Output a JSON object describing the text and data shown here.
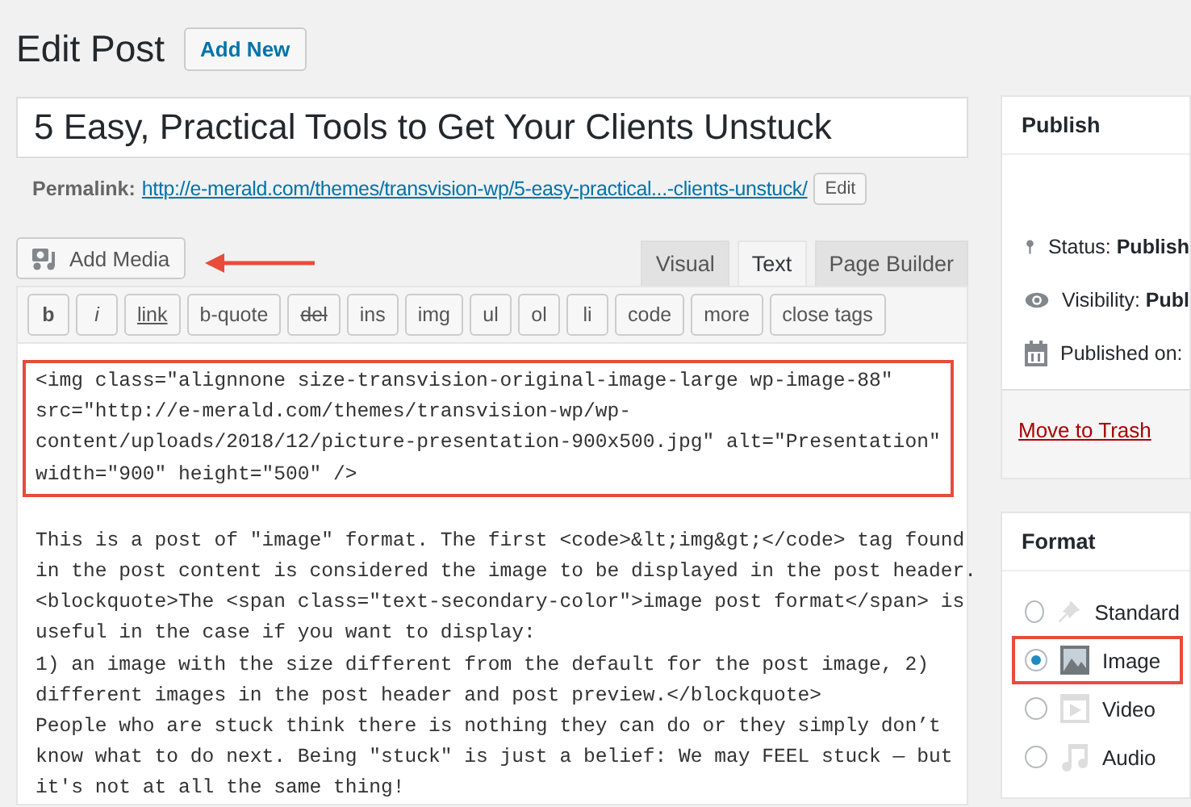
{
  "header": {
    "title": "Edit Post",
    "add_new": "Add New"
  },
  "post_title": {
    "value": "5 Easy, Practical Tools to Get Your Clients Unstuck"
  },
  "permalink": {
    "label": "Permalink:",
    "url": "http://e-merald.com/themes/transvision-wp/5-easy-practical...-clients-unstuck/",
    "edit": "Edit"
  },
  "add_media": {
    "label": "Add Media",
    "annotated": true
  },
  "tabs": [
    {
      "label": "Visual",
      "selected": false
    },
    {
      "label": "Text",
      "selected": true
    },
    {
      "label": "Page Builder",
      "selected": false
    }
  ],
  "toolbar": [
    {
      "label": "b",
      "kind": "bold"
    },
    {
      "label": "i",
      "kind": "italic"
    },
    {
      "label": "link",
      "kind": "underline"
    },
    {
      "label": "b-quote",
      "kind": "plain"
    },
    {
      "label": "del",
      "kind": "strike"
    },
    {
      "label": "ins",
      "kind": "plain"
    },
    {
      "label": "img",
      "kind": "plain"
    },
    {
      "label": "ul",
      "kind": "plain"
    },
    {
      "label": "ol",
      "kind": "plain"
    },
    {
      "label": "li",
      "kind": "plain"
    },
    {
      "label": "code",
      "kind": "plain"
    },
    {
      "label": "more",
      "kind": "plain"
    },
    {
      "label": "close tags",
      "kind": "plain"
    }
  ],
  "editor": {
    "blocks": [
      {
        "text": "<img class=\"alignnone size-transvision-original-image-large wp-image-88\"\nsrc=\"http://e-merald.com/themes/transvision-wp/wp-\ncontent/uploads/2018/12/picture-presentation-900x500.jpg\" alt=\"Presentation\"\nwidth=\"900\" height=\"500\" />",
        "highlighted": true
      },
      {
        "text": "This is a post of \"image\" format. The first <code>&lt;img&gt;</code> tag found\nin the post content is considered the image to be displayed in the post header.\n<blockquote>The <span class=\"text-secondary-color\">image post format</span> is\nuseful in the case if you want to display:\n1) an image with the size different from the default for the post image, 2)\ndifferent images in the post header and post preview.</blockquote>\nPeople who are stuck think there is nothing they can do or they simply don’t\nknow what to do next. Being \"stuck\" is just a belief: We may FEEL stuck — but\nit's not at all the same thing!",
        "highlighted": false
      }
    ]
  },
  "publish": {
    "title": "Publish",
    "rows": [
      {
        "kind": "status",
        "text": "Status: **Publish**"
      },
      {
        "kind": "visibility",
        "text": "Visibility: **Publ**"
      },
      {
        "kind": "date",
        "text": "Published on:"
      }
    ],
    "trash": "Move to Trash"
  },
  "format": {
    "title": "Format",
    "options": [
      {
        "kind": "standard",
        "label": "Standard",
        "selected": false,
        "highlighted": false
      },
      {
        "kind": "image",
        "label": "Image",
        "selected": true,
        "highlighted": true
      },
      {
        "kind": "video",
        "label": "Video",
        "selected": false,
        "highlighted": false
      },
      {
        "kind": "audio",
        "label": "Audio",
        "selected": false,
        "highlighted": false
      }
    ]
  }
}
